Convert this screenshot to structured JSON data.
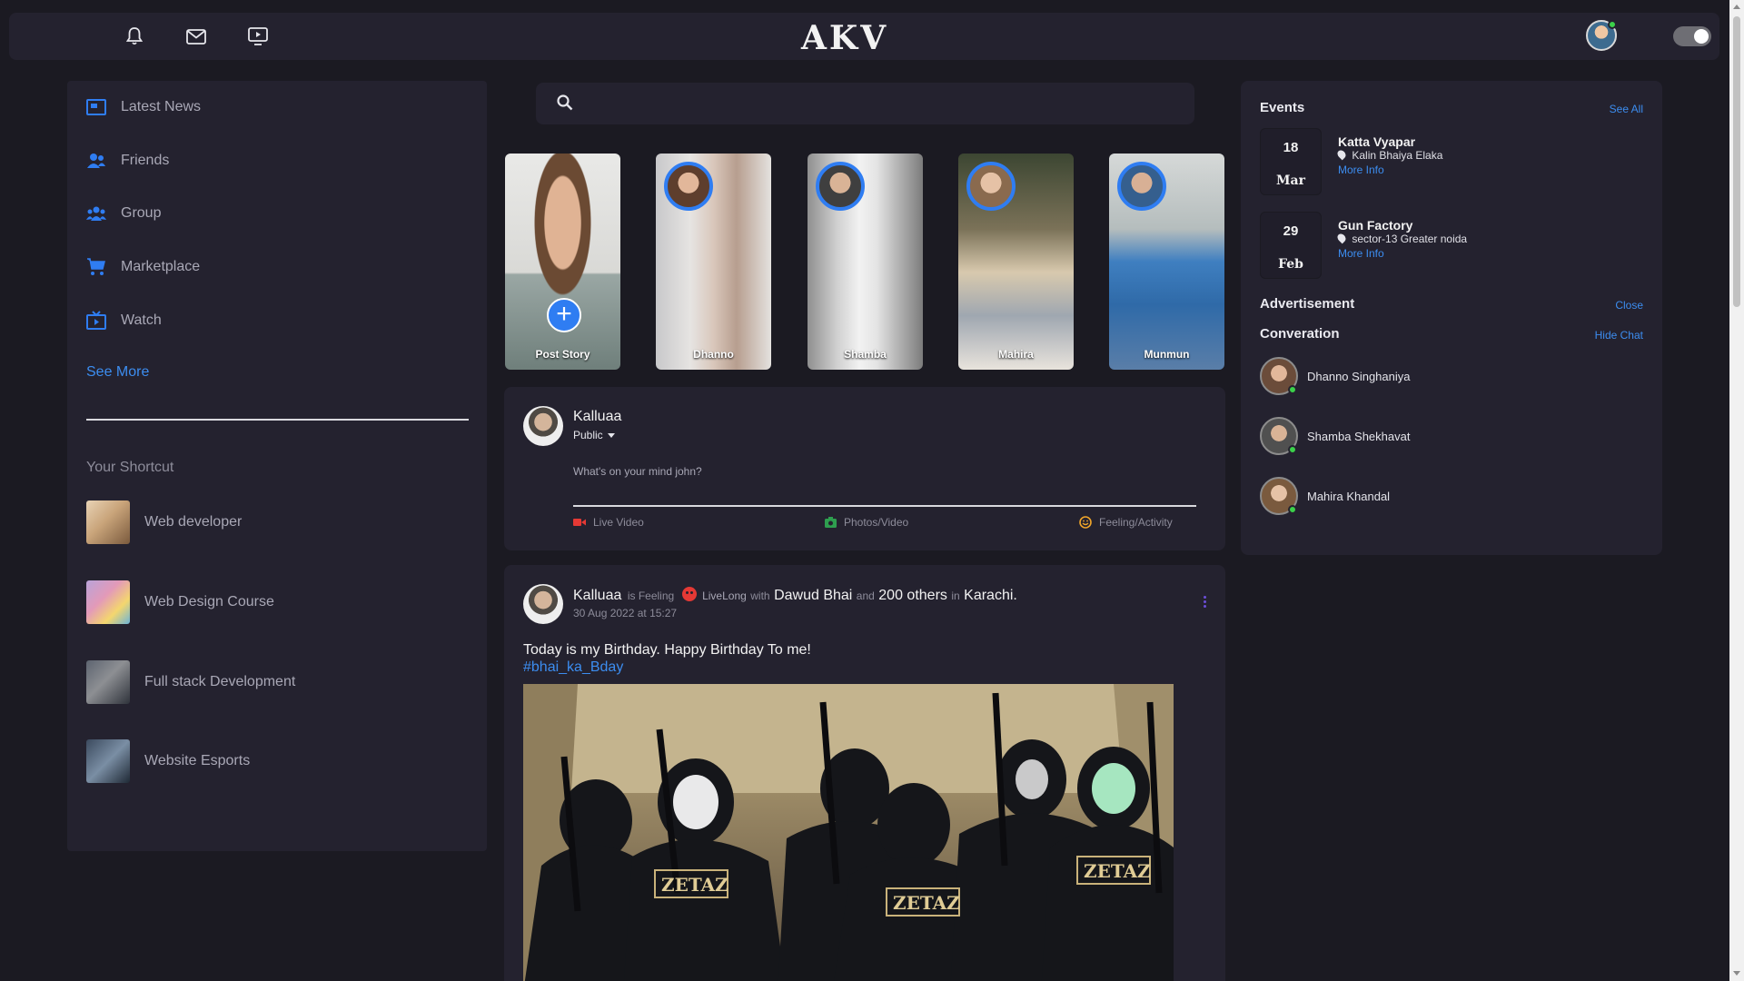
{
  "header": {
    "logo": "AKV",
    "icons": [
      "bell-icon",
      "mail-icon",
      "video-icon"
    ],
    "toggle_state": "on"
  },
  "sidebar": {
    "items": [
      {
        "label": "Latest News",
        "icon": "newspaper-icon"
      },
      {
        "label": "Friends",
        "icon": "friends-icon"
      },
      {
        "label": "Group",
        "icon": "group-icon"
      },
      {
        "label": "Marketplace",
        "icon": "cart-icon"
      },
      {
        "label": "Watch",
        "icon": "tv-icon"
      }
    ],
    "see_more": "See More",
    "shortcut_title": "Your Shortcut",
    "shortcuts": [
      {
        "label": "Web developer"
      },
      {
        "label": "Web Design Course"
      },
      {
        "label": "Full stack Development"
      },
      {
        "label": "Website Esports"
      }
    ]
  },
  "search": {
    "placeholder": ""
  },
  "stories": [
    {
      "label": "Post Story"
    },
    {
      "label": "Dhanno"
    },
    {
      "label": "Shamba"
    },
    {
      "label": "Mahira"
    },
    {
      "label": "Munmun"
    }
  ],
  "composer": {
    "name": "Kalluaa",
    "privacy": "Public",
    "placeholder": "What's on your mind john?",
    "actions": [
      {
        "label": "Live Video",
        "icon": "video-camera-icon",
        "color": "#e53935"
      },
      {
        "label": "Photos/Video",
        "icon": "camera-icon",
        "color": "#2e9e4f"
      },
      {
        "label": "Feeling/Activity",
        "icon": "smile-icon",
        "color": "#f0a52a"
      }
    ]
  },
  "post": {
    "author": "Kalluaa",
    "is_feeling": "is Feeling",
    "feeling": "LiveLong",
    "with": "with",
    "friend": "Dawud Bhai",
    "and": "and",
    "others": "200 others",
    "in": "in",
    "place": "Karachi.",
    "timestamp": "30 Aug 2022 at 15:27",
    "text": "Today is my Birthday. Happy Birthday To me!",
    "hashtag": "#bhai_ka_Bday",
    "badge_text": "ZETAZ"
  },
  "events": {
    "title": "Events",
    "see_all": "See All",
    "items": [
      {
        "day": "18",
        "month": "Mar",
        "name": "Katta Vyapar",
        "location": "Kalin Bhaiya Elaka",
        "more": "More Info"
      },
      {
        "day": "29",
        "month": "Feb",
        "name": "Gun Factory",
        "location": "sector-13 Greater noida",
        "more": "More Info"
      }
    ]
  },
  "advertisement": {
    "title": "Advertisement",
    "close": "Close"
  },
  "conversation": {
    "title": "Converation",
    "hide": "Hide Chat",
    "people": [
      {
        "name": "Dhanno Singhaniya"
      },
      {
        "name": "Shamba Shekhavat"
      },
      {
        "name": "Mahira Khandal"
      }
    ]
  },
  "colors": {
    "accent": "#2f7df2",
    "link": "#3c8df0",
    "panel": "#24222f",
    "background": "#1b1a22",
    "online": "#3bd14a"
  }
}
